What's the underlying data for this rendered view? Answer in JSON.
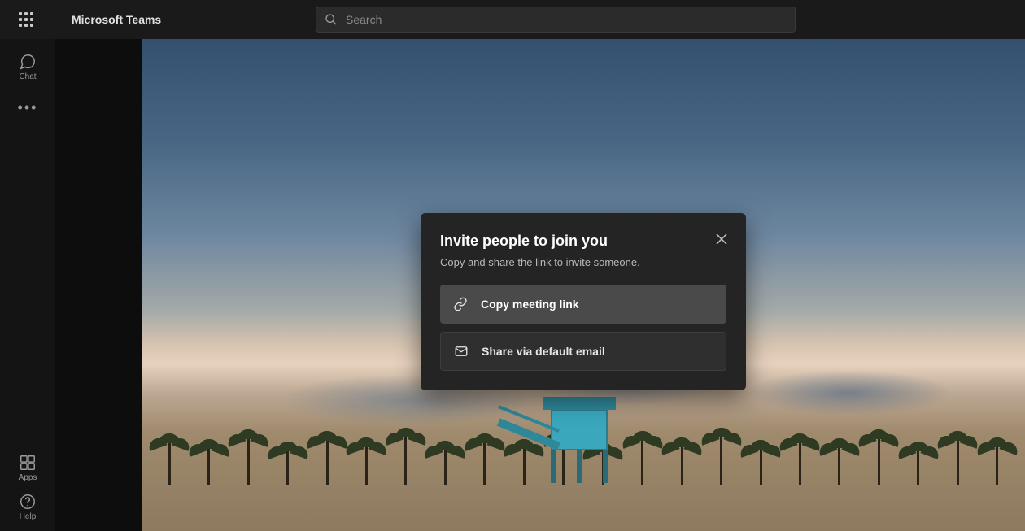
{
  "header": {
    "app_title": "Microsoft Teams",
    "search_placeholder": "Search"
  },
  "nav": {
    "chat_label": "Chat",
    "apps_label": "Apps",
    "help_label": "Help"
  },
  "modal": {
    "title": "Invite people to join you",
    "subtitle": "Copy and share the link to invite someone.",
    "copy_link_label": "Copy meeting link",
    "share_email_label": "Share via default email"
  }
}
